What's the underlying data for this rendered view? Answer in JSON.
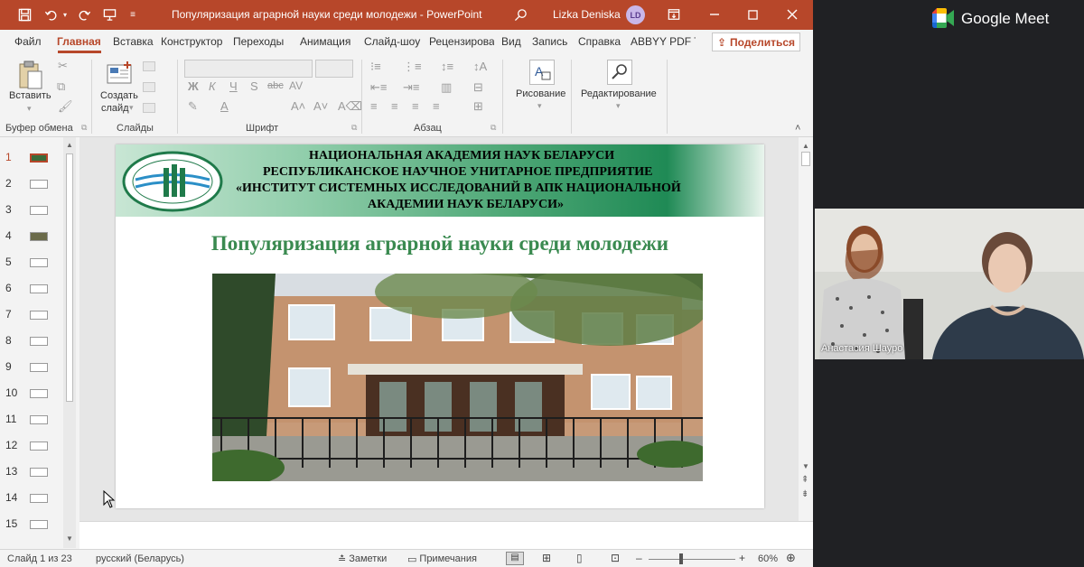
{
  "window": {
    "doc_title": "Популяризация аграрной науки среди молодежи  -  PowerPoint",
    "user_name": "Lizka Deniska",
    "user_initials": "LD"
  },
  "menu": {
    "tabs": [
      "Файл",
      "Главная",
      "Вставка",
      "Конструктор",
      "Переходы",
      "Анимация",
      "Слайд-шоу",
      "Рецензирова",
      "Вид",
      "Запись",
      "Справка",
      "ABBYY PDF Tr"
    ],
    "active_tab": "Главная",
    "share_label": "Поделиться"
  },
  "ribbon": {
    "paste_label": "Вставить",
    "new_slide_label_1": "Создать",
    "new_slide_label_2": "слайд",
    "drawing_label": "Рисование",
    "editing_label": "Редактирование",
    "groups": {
      "clipboard": "Буфер обмена",
      "slides": "Слайды",
      "font": "Шрифт",
      "paragraph": "Абзац"
    },
    "font_buttons": [
      "Ж",
      "К",
      "Ч",
      "S",
      "abc",
      "AV"
    ]
  },
  "thumbnails": {
    "numbers": [
      "1",
      "2",
      "3",
      "4",
      "5",
      "6",
      "7",
      "8",
      "9",
      "10",
      "11",
      "12",
      "13",
      "14",
      "15"
    ],
    "active": "1"
  },
  "slide": {
    "header_lines": [
      "НАЦИОНАЛЬНАЯ АКАДЕМИЯ НАУК БЕЛАРУСИ",
      "РЕСПУБЛИКАНСКОЕ  НАУЧНОЕ УНИТАРНОЕ ПРЕДПРИЯТИЕ",
      "«ИНСТИТУТ СИСТЕМНЫХ ИССЛЕДОВАНИЙ В АПК НАЦИОНАЛЬНОЙ",
      "АКАДЕМИИ НАУК БЕЛАРУСИ»"
    ],
    "title": "Популяризация аграрной науки среди молодежи"
  },
  "status": {
    "slide_counter": "Слайд 1 из 23",
    "language": "русский (Беларусь)",
    "notes_label": "Заметки",
    "comments_label": "Примечания",
    "zoom_minus": "–",
    "zoom_plus": "+",
    "zoom": "60%",
    "zoom_level_fraction": 0.38
  },
  "meet": {
    "app_name": "Google Meet",
    "participant_name": "Анастасия Шауро"
  },
  "colors": {
    "ppt_accent": "#b7472a",
    "slide_title": "#3a8a50",
    "meet_bg": "#202124"
  }
}
